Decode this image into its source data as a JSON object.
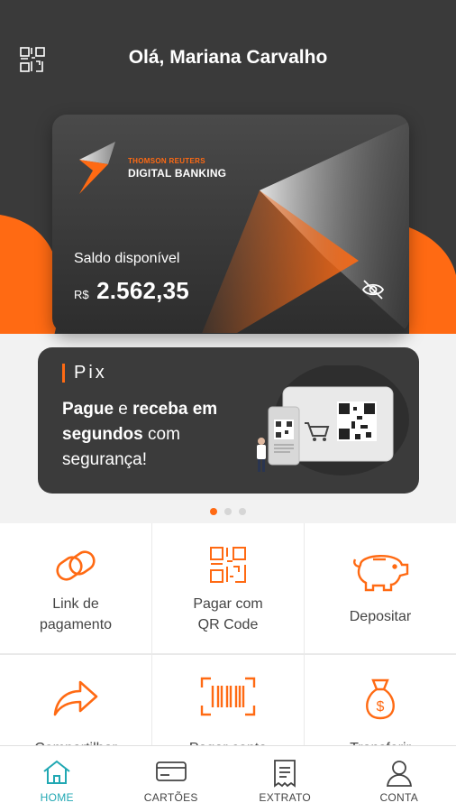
{
  "header": {
    "greeting": "Olá, Mariana Carvalho"
  },
  "card": {
    "brand_top": "THOMSON REUTERS",
    "brand_main": "DIGITAL BANKING",
    "balance_label": "Saldo disponível",
    "currency": "R$",
    "balance": "2.562,35"
  },
  "pix": {
    "title": "Pix",
    "text_1": "Pague",
    "text_2": " e ",
    "text_3": "receba em segundos",
    "text_4": " com segurança!"
  },
  "carousel": {
    "pages": 3,
    "active": 0
  },
  "actions": [
    {
      "label": "Link de\npagamento",
      "icon": "link-icon"
    },
    {
      "label": "Pagar com\nQR Code",
      "icon": "qr-code-icon"
    },
    {
      "label": "Depositar",
      "icon": "piggy-bank-icon"
    },
    {
      "label": "Compartilhar",
      "icon": "share-arrow-icon"
    },
    {
      "label": "Pagar conta",
      "icon": "barcode-icon"
    },
    {
      "label": "Transferir",
      "icon": "money-bag-icon"
    }
  ],
  "nav": {
    "home": "HOME",
    "cards": "CARTÕES",
    "statement": "EXTRATO",
    "account": "CONTA"
  },
  "colors": {
    "accent": "#ff6a13",
    "dark": "#3a3a3a",
    "active_nav": "#21a8b3"
  }
}
